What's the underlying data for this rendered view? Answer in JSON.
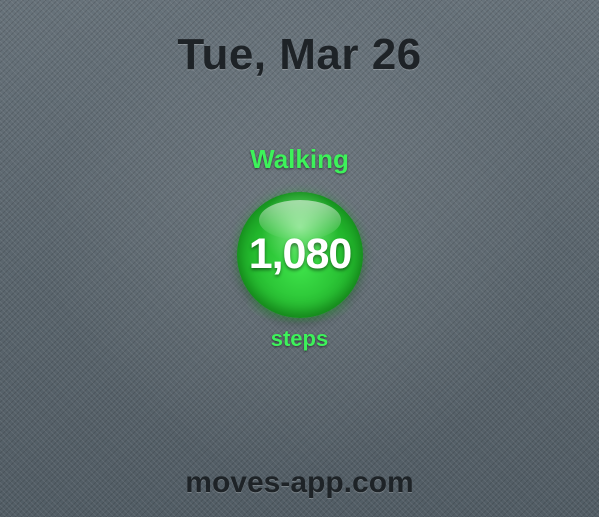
{
  "header": {
    "date": "Tue, Mar 26"
  },
  "activity": {
    "label": "Walking",
    "count": "1,080",
    "unit": "steps"
  },
  "footer": {
    "url": "moves-app.com"
  },
  "colors": {
    "accent": "#3df25a",
    "bubble": "#22b62c",
    "text_dark": "#1e2327",
    "background": "#5f6a72"
  }
}
